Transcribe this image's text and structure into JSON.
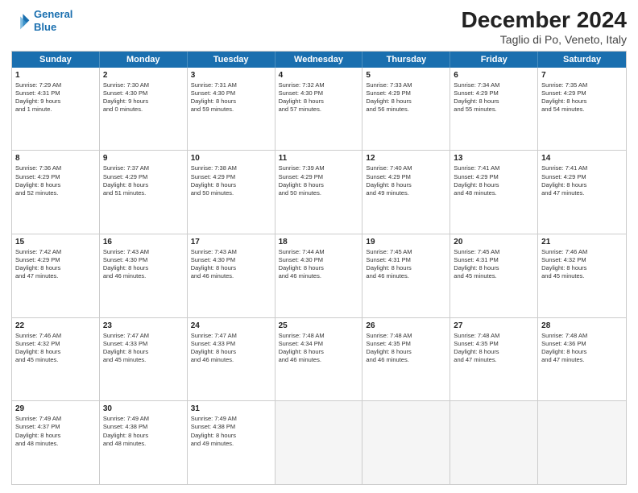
{
  "logo": {
    "line1": "General",
    "line2": "Blue"
  },
  "title": "December 2024",
  "subtitle": "Taglio di Po, Veneto, Italy",
  "weekdays": [
    "Sunday",
    "Monday",
    "Tuesday",
    "Wednesday",
    "Thursday",
    "Friday",
    "Saturday"
  ],
  "weeks": [
    [
      {
        "day": "1",
        "text": "Sunrise: 7:29 AM\nSunset: 4:31 PM\nDaylight: 9 hours\nand 1 minute."
      },
      {
        "day": "2",
        "text": "Sunrise: 7:30 AM\nSunset: 4:30 PM\nDaylight: 9 hours\nand 0 minutes."
      },
      {
        "day": "3",
        "text": "Sunrise: 7:31 AM\nSunset: 4:30 PM\nDaylight: 8 hours\nand 59 minutes."
      },
      {
        "day": "4",
        "text": "Sunrise: 7:32 AM\nSunset: 4:30 PM\nDaylight: 8 hours\nand 57 minutes."
      },
      {
        "day": "5",
        "text": "Sunrise: 7:33 AM\nSunset: 4:29 PM\nDaylight: 8 hours\nand 56 minutes."
      },
      {
        "day": "6",
        "text": "Sunrise: 7:34 AM\nSunset: 4:29 PM\nDaylight: 8 hours\nand 55 minutes."
      },
      {
        "day": "7",
        "text": "Sunrise: 7:35 AM\nSunset: 4:29 PM\nDaylight: 8 hours\nand 54 minutes."
      }
    ],
    [
      {
        "day": "8",
        "text": "Sunrise: 7:36 AM\nSunset: 4:29 PM\nDaylight: 8 hours\nand 52 minutes."
      },
      {
        "day": "9",
        "text": "Sunrise: 7:37 AM\nSunset: 4:29 PM\nDaylight: 8 hours\nand 51 minutes."
      },
      {
        "day": "10",
        "text": "Sunrise: 7:38 AM\nSunset: 4:29 PM\nDaylight: 8 hours\nand 50 minutes."
      },
      {
        "day": "11",
        "text": "Sunrise: 7:39 AM\nSunset: 4:29 PM\nDaylight: 8 hours\nand 50 minutes."
      },
      {
        "day": "12",
        "text": "Sunrise: 7:40 AM\nSunset: 4:29 PM\nDaylight: 8 hours\nand 49 minutes."
      },
      {
        "day": "13",
        "text": "Sunrise: 7:41 AM\nSunset: 4:29 PM\nDaylight: 8 hours\nand 48 minutes."
      },
      {
        "day": "14",
        "text": "Sunrise: 7:41 AM\nSunset: 4:29 PM\nDaylight: 8 hours\nand 47 minutes."
      }
    ],
    [
      {
        "day": "15",
        "text": "Sunrise: 7:42 AM\nSunset: 4:29 PM\nDaylight: 8 hours\nand 47 minutes."
      },
      {
        "day": "16",
        "text": "Sunrise: 7:43 AM\nSunset: 4:30 PM\nDaylight: 8 hours\nand 46 minutes."
      },
      {
        "day": "17",
        "text": "Sunrise: 7:43 AM\nSunset: 4:30 PM\nDaylight: 8 hours\nand 46 minutes."
      },
      {
        "day": "18",
        "text": "Sunrise: 7:44 AM\nSunset: 4:30 PM\nDaylight: 8 hours\nand 46 minutes."
      },
      {
        "day": "19",
        "text": "Sunrise: 7:45 AM\nSunset: 4:31 PM\nDaylight: 8 hours\nand 46 minutes."
      },
      {
        "day": "20",
        "text": "Sunrise: 7:45 AM\nSunset: 4:31 PM\nDaylight: 8 hours\nand 45 minutes."
      },
      {
        "day": "21",
        "text": "Sunrise: 7:46 AM\nSunset: 4:32 PM\nDaylight: 8 hours\nand 45 minutes."
      }
    ],
    [
      {
        "day": "22",
        "text": "Sunrise: 7:46 AM\nSunset: 4:32 PM\nDaylight: 8 hours\nand 45 minutes."
      },
      {
        "day": "23",
        "text": "Sunrise: 7:47 AM\nSunset: 4:33 PM\nDaylight: 8 hours\nand 45 minutes."
      },
      {
        "day": "24",
        "text": "Sunrise: 7:47 AM\nSunset: 4:33 PM\nDaylight: 8 hours\nand 46 minutes."
      },
      {
        "day": "25",
        "text": "Sunrise: 7:48 AM\nSunset: 4:34 PM\nDaylight: 8 hours\nand 46 minutes."
      },
      {
        "day": "26",
        "text": "Sunrise: 7:48 AM\nSunset: 4:35 PM\nDaylight: 8 hours\nand 46 minutes."
      },
      {
        "day": "27",
        "text": "Sunrise: 7:48 AM\nSunset: 4:35 PM\nDaylight: 8 hours\nand 47 minutes."
      },
      {
        "day": "28",
        "text": "Sunrise: 7:48 AM\nSunset: 4:36 PM\nDaylight: 8 hours\nand 47 minutes."
      }
    ],
    [
      {
        "day": "29",
        "text": "Sunrise: 7:49 AM\nSunset: 4:37 PM\nDaylight: 8 hours\nand 48 minutes."
      },
      {
        "day": "30",
        "text": "Sunrise: 7:49 AM\nSunset: 4:38 PM\nDaylight: 8 hours\nand 48 minutes."
      },
      {
        "day": "31",
        "text": "Sunrise: 7:49 AM\nSunset: 4:38 PM\nDaylight: 8 hours\nand 49 minutes."
      },
      {
        "day": "",
        "text": ""
      },
      {
        "day": "",
        "text": ""
      },
      {
        "day": "",
        "text": ""
      },
      {
        "day": "",
        "text": ""
      }
    ]
  ]
}
